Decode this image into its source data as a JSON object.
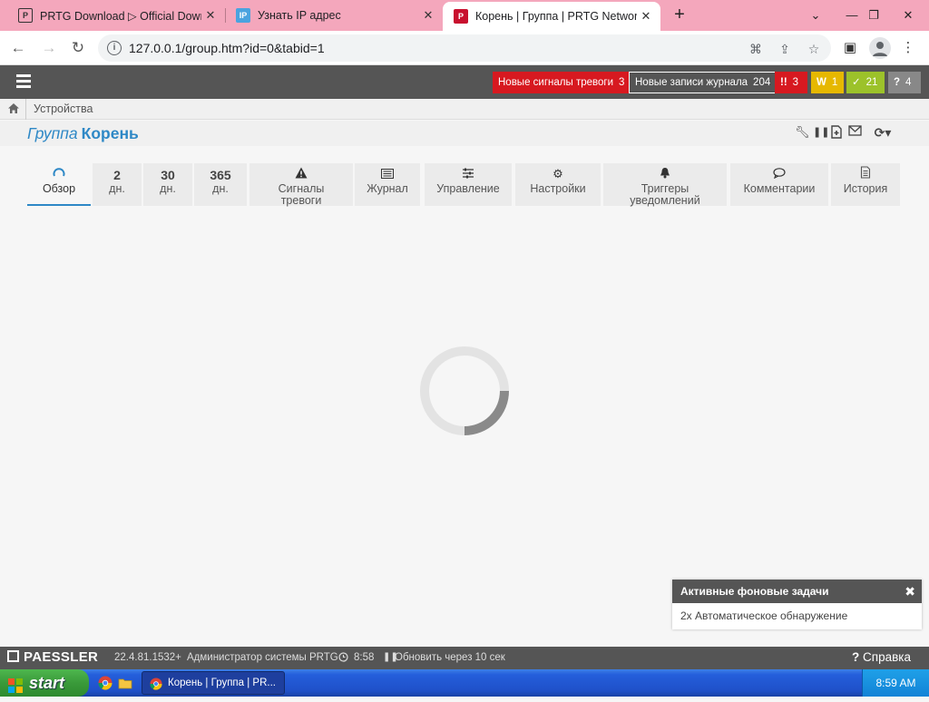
{
  "browser": {
    "tabs": [
      {
        "title": "PRTG Download ▷ Official Down",
        "favicon": "prtg-icon"
      },
      {
        "title": "Узнать IP адрес",
        "favicon": "ip-icon"
      },
      {
        "title": "Корень | Группа | PRTG Network",
        "favicon": "prtg-red-icon",
        "active": true
      }
    ],
    "new_tab": "+",
    "url": "127.0.0.1/group.htm?id=0&tabid=1"
  },
  "prtg": {
    "alerts": {
      "new_alarms_label": "Новые сигналы тревоги",
      "new_alarms_count": "3",
      "new_log_label": "Новые записи журнала",
      "new_log_count": "204",
      "down_count": "3",
      "warning_count": "1",
      "up_count": "21",
      "unknown_count": "4",
      "down_symbol": "!!",
      "warning_symbol": "W",
      "up_symbol": "✓",
      "unknown_symbol": "?"
    },
    "breadcrumb": "Устройства",
    "title": {
      "kind": "Группа",
      "name": "Корень"
    },
    "tabs": [
      {
        "kind": "icon",
        "icon": "gauge-icon",
        "label": "Обзор",
        "active": true
      },
      {
        "kind": "num",
        "num": "2",
        "label": "дн."
      },
      {
        "kind": "num",
        "num": "30",
        "label": "дн."
      },
      {
        "kind": "num",
        "num": "365",
        "label": "дн."
      },
      {
        "kind": "icon",
        "icon": "warning-icon",
        "label": "Сигналы тревоги"
      },
      {
        "kind": "icon",
        "icon": "log-icon",
        "label": "Журнал"
      },
      {
        "kind": "icon",
        "icon": "sliders-icon",
        "label": "Управление"
      },
      {
        "kind": "icon",
        "icon": "gear-icon",
        "label": "Настройки"
      },
      {
        "kind": "icon",
        "icon": "bell-icon",
        "label": "Триггеры уведомлений"
      },
      {
        "kind": "icon",
        "icon": "comment-icon",
        "label": "Комментарии"
      },
      {
        "kind": "icon",
        "icon": "history-icon",
        "label": "История"
      }
    ],
    "background_tasks": {
      "title": "Активные фоновые задачи",
      "item": "2x Автоматическое обнаружение"
    },
    "footer": {
      "brand": "PAESSLER",
      "version": "22.4.81.1532+",
      "user": "Администратор системы PRTG",
      "time": "8:58",
      "refresh": "Обновить через 10 сек",
      "help": "Справка"
    }
  },
  "taskbar": {
    "start_label": "start",
    "window_title": "Корень | Группа | PR...",
    "clock": "8:59 AM"
  },
  "colors": {
    "accent": "#2e88c6",
    "alarm_red": "#d71920",
    "warning_yellow": "#e6b800",
    "ok_green": "#9cc22a",
    "tab_strip": "#f4a7bc"
  }
}
